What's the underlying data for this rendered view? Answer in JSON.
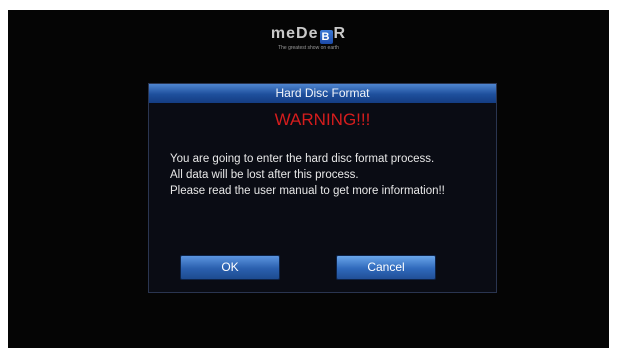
{
  "logo": {
    "text_before": "meDe",
    "text_box": "B",
    "text_after": "R",
    "tagline": "The greatest show on earth"
  },
  "dialog": {
    "title": "Hard Disc Format",
    "warning": "WARNING!!!",
    "lines": [
      "You are going to enter the hard disc format process.",
      "All data will be lost after this process.",
      "Please read the user manual to get more information!!"
    ],
    "ok_label": "OK",
    "cancel_label": "Cancel"
  },
  "colors": {
    "title_bar": "#1e4f9c",
    "warning_text": "#d51d1d",
    "button": "#2a5fae",
    "background": "#050505"
  }
}
